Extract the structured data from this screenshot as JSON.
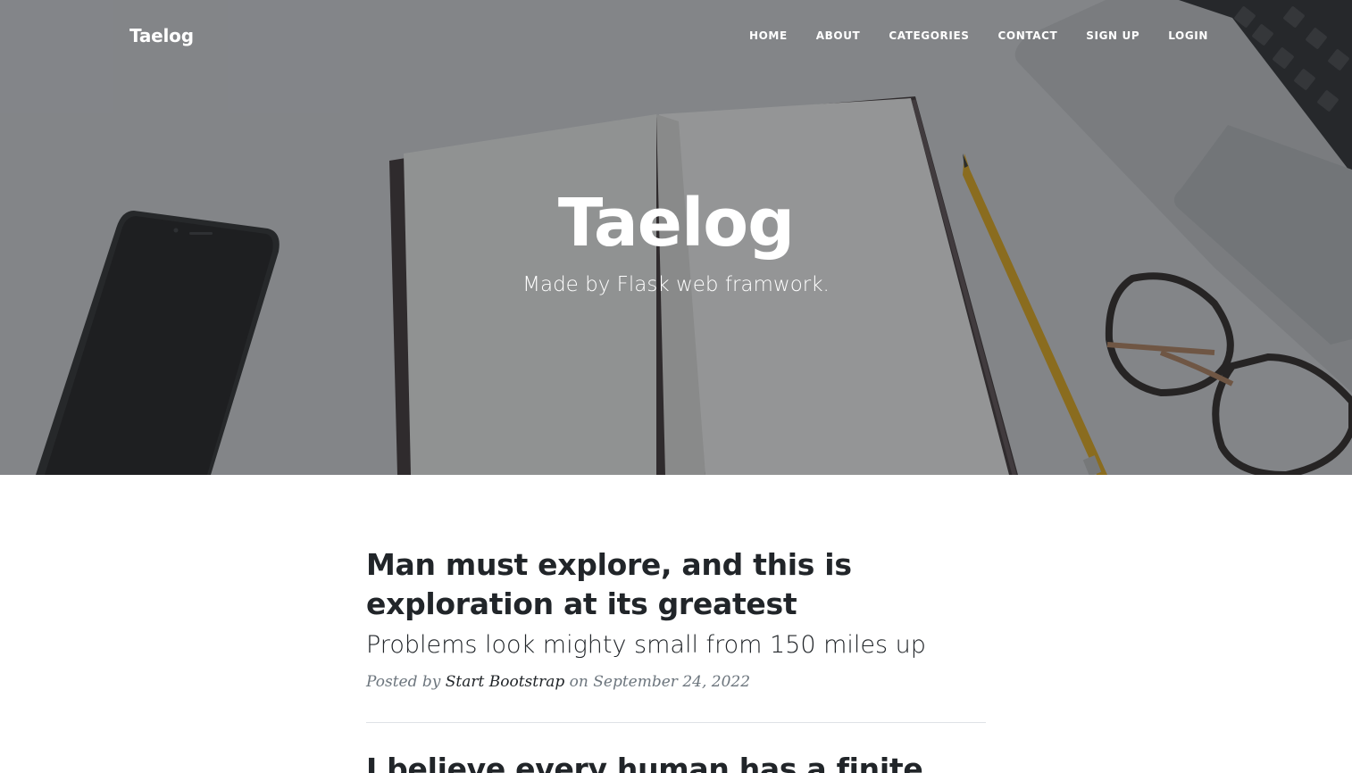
{
  "navbar": {
    "brand": "Taelog",
    "items": [
      {
        "label": "Home"
      },
      {
        "label": "About"
      },
      {
        "label": "Categories"
      },
      {
        "label": "Contact"
      },
      {
        "label": "Sign Up"
      },
      {
        "label": "Login"
      }
    ]
  },
  "hero": {
    "title": "Taelog",
    "subtitle": "Made by Flask web framwork."
  },
  "posts": [
    {
      "title": "Man must explore, and this is exploration at its greatest",
      "subtitle": "Problems look mighty small from 150 miles up",
      "meta_prefix": "Posted by",
      "author": "Start Bootstrap",
      "meta_on": "on",
      "date": "September 24, 2022"
    },
    {
      "title": "I believe every human has a finite"
    }
  ],
  "colors": {
    "text_dark": "#212529",
    "meta_gray": "#6c757d",
    "divider": "#dee2e6",
    "white": "#ffffff"
  }
}
